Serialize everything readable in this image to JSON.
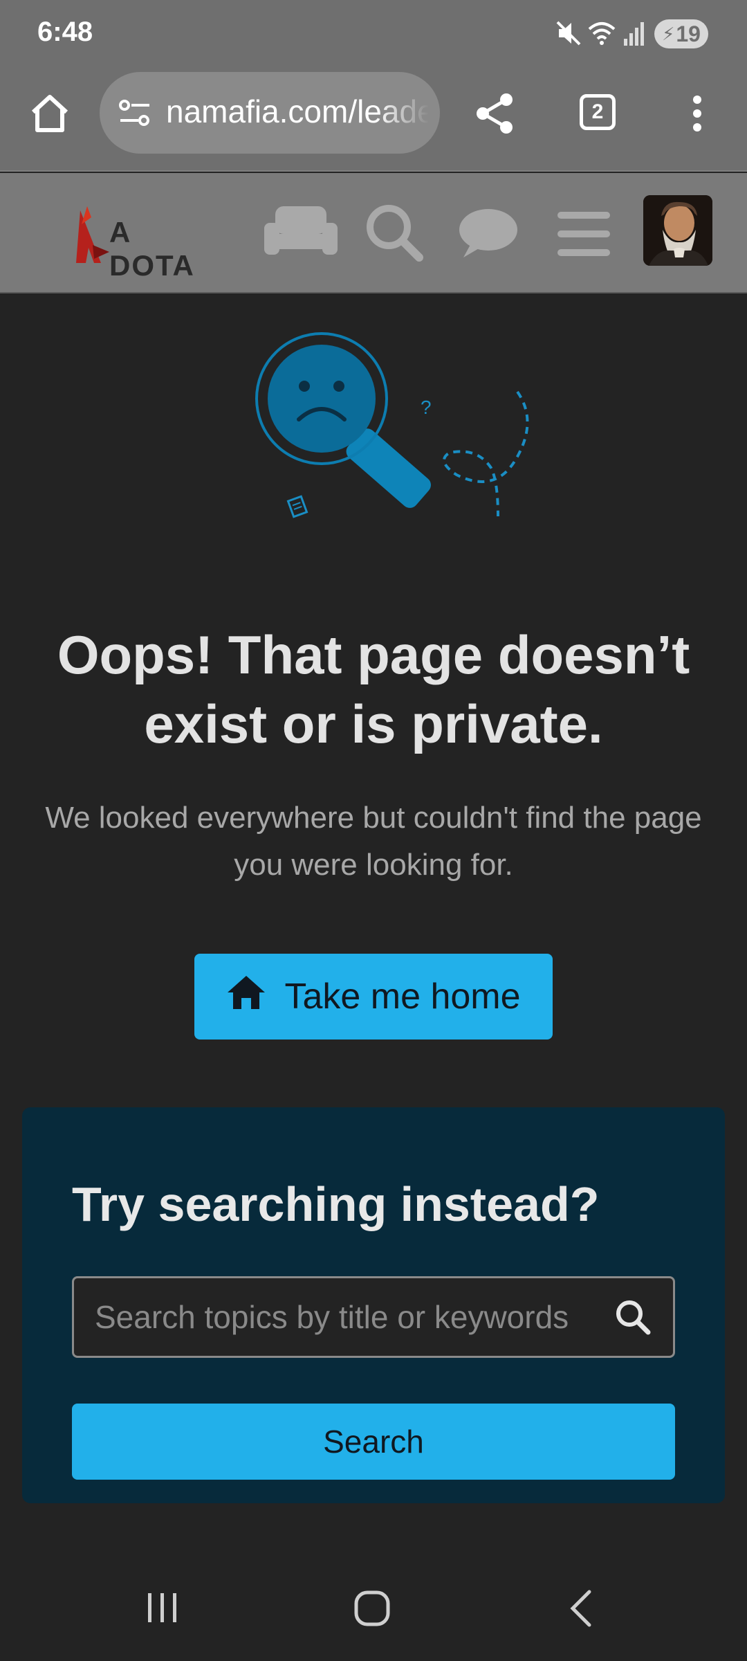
{
  "status_bar": {
    "time": "6:48",
    "battery": "19",
    "icons": [
      "mute-icon",
      "wifi-icon",
      "signal-icon",
      "charging-icon"
    ]
  },
  "browser": {
    "url": "namafia.com/leaderboard",
    "tab_count": "2",
    "icons": [
      "home-icon",
      "site-settings-icon",
      "share-icon",
      "tabs-icon",
      "menu-kebab-icon"
    ]
  },
  "site_nav": {
    "logo_text": "A DOTA",
    "icons": [
      "sofa-icon",
      "search-icon",
      "chat-bubble-icon",
      "hamburger-menu-icon",
      "avatar"
    ]
  },
  "error": {
    "heading": "Oops! That page doesn’t exist or is private.",
    "subtext": "We looked everywhere but couldn't find the page you were looking for.",
    "home_button": "Take me home",
    "illustration_glyph": "?"
  },
  "search": {
    "title": "Try searching instead?",
    "placeholder": "Search topics by title or keywords",
    "button": "Search"
  },
  "colors": {
    "accent": "#22b0ea",
    "card": "#072a3b",
    "page_bg": "#232323",
    "toolbar": "#6f6f6f"
  }
}
